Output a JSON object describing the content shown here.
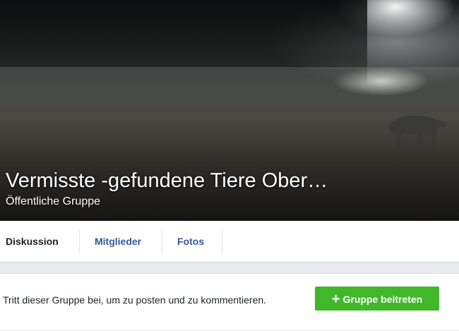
{
  "group": {
    "title": "Vermisste -gefundene Tiere Ober…",
    "privacy": "Öffentliche Gruppe"
  },
  "tabs": [
    {
      "label": "Diskussion",
      "active": true
    },
    {
      "label": "Mitglieder",
      "active": false
    },
    {
      "label": "Fotos",
      "active": false
    }
  ],
  "join_prompt": {
    "text": "Tritt dieser Gruppe bei, um zu posten und zu kommentieren.",
    "button_label": "Gruppe beitreten",
    "button_icon": "plus-icon"
  },
  "colors": {
    "link": "#365899",
    "join_button": "#42b72a",
    "background": "#e9ebee"
  }
}
